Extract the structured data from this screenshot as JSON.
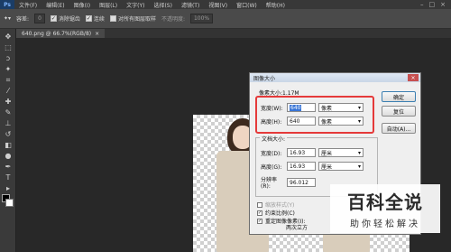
{
  "menubar": {
    "logo": "Ps",
    "items": [
      "文件(F)",
      "编辑(E)",
      "图像(I)",
      "图层(L)",
      "文字(Y)",
      "选择(S)",
      "滤镜(T)",
      "视图(V)",
      "窗口(W)",
      "帮助(H)"
    ],
    "controls": [
      "–",
      "□",
      "×"
    ]
  },
  "options": {
    "size_label": "容差:",
    "size_value": "0",
    "antialias": "消除锯齿",
    "contiguous": "连续",
    "sample_all": "对所有图层取样",
    "opacity_label": "不透明度:",
    "opacity_value": "100%"
  },
  "tab": {
    "label": "640.png @ 66.7%(RGB/8)",
    "close": "×"
  },
  "dialog": {
    "title": "图像大小",
    "pixel_dimensions": "像素大小:1.17M",
    "width_label": "宽度(W):",
    "width_value": "640",
    "height_label": "高度(H):",
    "height_value": "640",
    "pixel_unit": "像素",
    "doc_size_title": "文档大小:",
    "doc_width_label": "宽度(D):",
    "doc_width_value": "16.93",
    "doc_height_label": "高度(G):",
    "doc_height_value": "16.93",
    "cm_unit": "厘米",
    "resolution_label": "分辨率(R):",
    "resolution_value": "96.012",
    "scale_styles": "缩放样式(Y)",
    "constrain": "约束比例(C)",
    "resample": "重定图像像素(I):",
    "resample_method": "两次立方",
    "ok": "确定",
    "reset": "复位",
    "auto": "自动(A)...",
    "close": "×"
  },
  "watermark": {
    "big": "百科全说",
    "small": "助你轻松解决"
  }
}
